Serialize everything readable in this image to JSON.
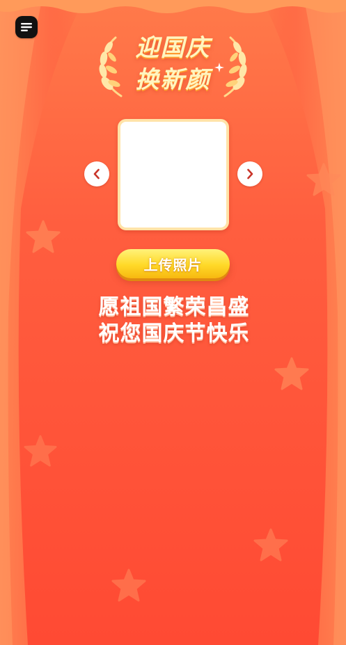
{
  "header": {
    "menu_icon": "menu-icon"
  },
  "title": {
    "line1": "迎国庆",
    "line2": "换新颜",
    "color": "#fff5c0"
  },
  "photo": {
    "prev_icon": "chevron-left-icon",
    "next_icon": "chevron-right-icon"
  },
  "upload": {
    "label": "上传照片",
    "color": "#ffd928"
  },
  "blessing": {
    "line1": "愿祖国繁荣昌盛",
    "line2": "祝您国庆节快乐"
  },
  "theme": {
    "background": "#ff5a3d",
    "accent": "#c9352a"
  }
}
